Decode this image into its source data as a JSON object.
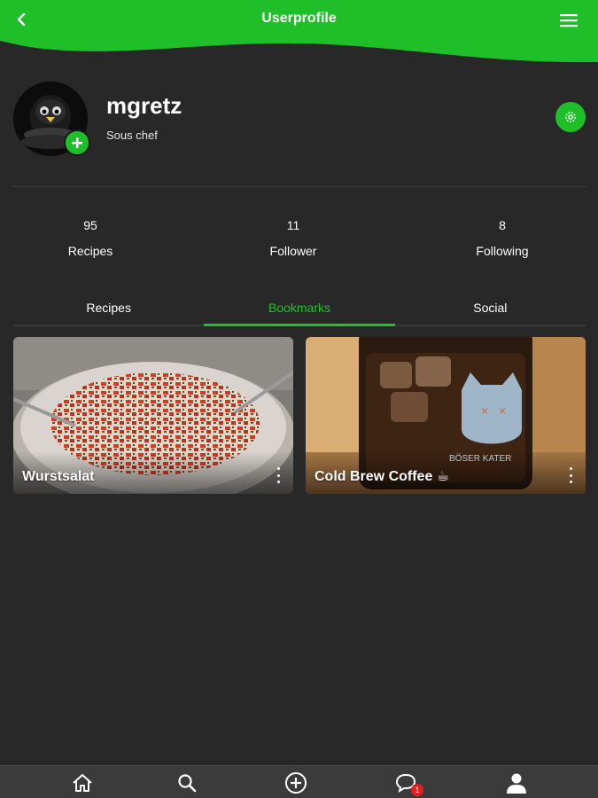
{
  "header": {
    "title": "Userprofile",
    "accent_color": "#1fbf2a"
  },
  "profile": {
    "username": "mgretz",
    "role": "Sous chef"
  },
  "stats": [
    {
      "value": "95",
      "label": "Recipes"
    },
    {
      "value": "11",
      "label": "Follower"
    },
    {
      "value": "8",
      "label": "Following"
    }
  ],
  "tabs": [
    {
      "label": "Recipes",
      "active": false
    },
    {
      "label": "Bookmarks",
      "active": true
    },
    {
      "label": "Social",
      "active": false
    }
  ],
  "cards": [
    {
      "title": "Wurstsalat"
    },
    {
      "title": "Cold Brew Coffee ☕"
    }
  ],
  "bottom_nav": {
    "items": [
      "home-icon",
      "search-icon",
      "add-circle-icon",
      "chat-icon",
      "person-icon"
    ],
    "chat_badge": "1"
  }
}
